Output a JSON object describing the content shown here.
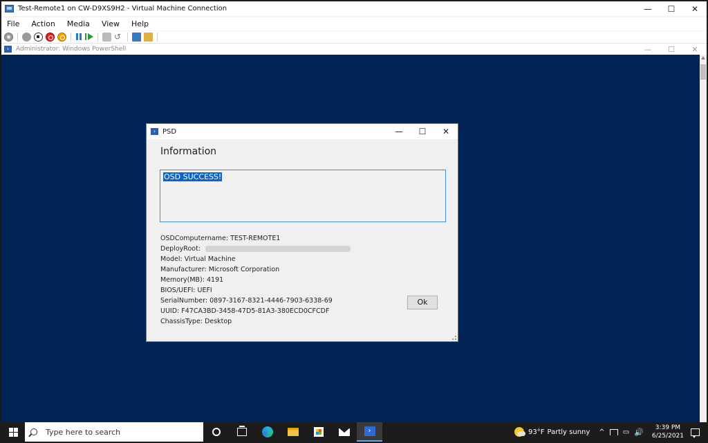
{
  "vm_window": {
    "title": "Test-Remote1 on CW-D9XS9H2 - Virtual Machine Connection",
    "controls": {
      "minimize": "—",
      "maximize": "☐",
      "close": "✕"
    }
  },
  "menu": {
    "items": [
      "File",
      "Action",
      "Media",
      "View",
      "Help"
    ]
  },
  "toolbar": {
    "buttons": [
      "ctrl-alt-del-icon",
      "start-icon",
      "turn-off-icon",
      "shut-down-icon",
      "save-icon",
      "pause-icon",
      "resume-icon",
      "checkpoint-icon",
      "revert-icon",
      "enhanced-session-icon",
      "share-icon"
    ]
  },
  "powershell_window": {
    "title": "Administrator: Windows PowerShell",
    "background": "#012456",
    "controls": {
      "minimize": "—",
      "maximize": "☐",
      "close": "✕"
    }
  },
  "psd_dialog": {
    "title": "PSD",
    "heading": "Information",
    "output_text": "OSD SUCCESS!",
    "info_rows": [
      {
        "label": "OSDComputername:",
        "value": "TEST-REMOTE1"
      },
      {
        "label": "DeployRoot:",
        "value": ""
      },
      {
        "label": "Model:",
        "value": "Virtual Machine"
      },
      {
        "label": "Manufacturer:",
        "value": "Microsoft Corporation"
      },
      {
        "label": "Memory(MB):",
        "value": "4191"
      },
      {
        "label": "BIOS/UEFI:",
        "value": "UEFI"
      },
      {
        "label": "SerialNumber:",
        "value": "0897-3167-8321-4446-7903-6338-69"
      },
      {
        "label": "UUID:",
        "value": "F47CA3BD-3458-47D5-81A3-380ECD0CFCDF"
      },
      {
        "label": "ChassisType:",
        "value": "Desktop"
      }
    ],
    "ok_label": "Ok",
    "controls": {
      "minimize": "—",
      "maximize": "☐",
      "close": "✕"
    },
    "selection_color": "#0a64c9"
  },
  "taskbar": {
    "search_placeholder": "Type here to search",
    "weather": {
      "temp": "93°F",
      "condition": "Partly sunny"
    },
    "clock": {
      "time": "3:39 PM",
      "date": "6/25/2021"
    },
    "tray_chevron": "^",
    "volume": "🔊"
  }
}
